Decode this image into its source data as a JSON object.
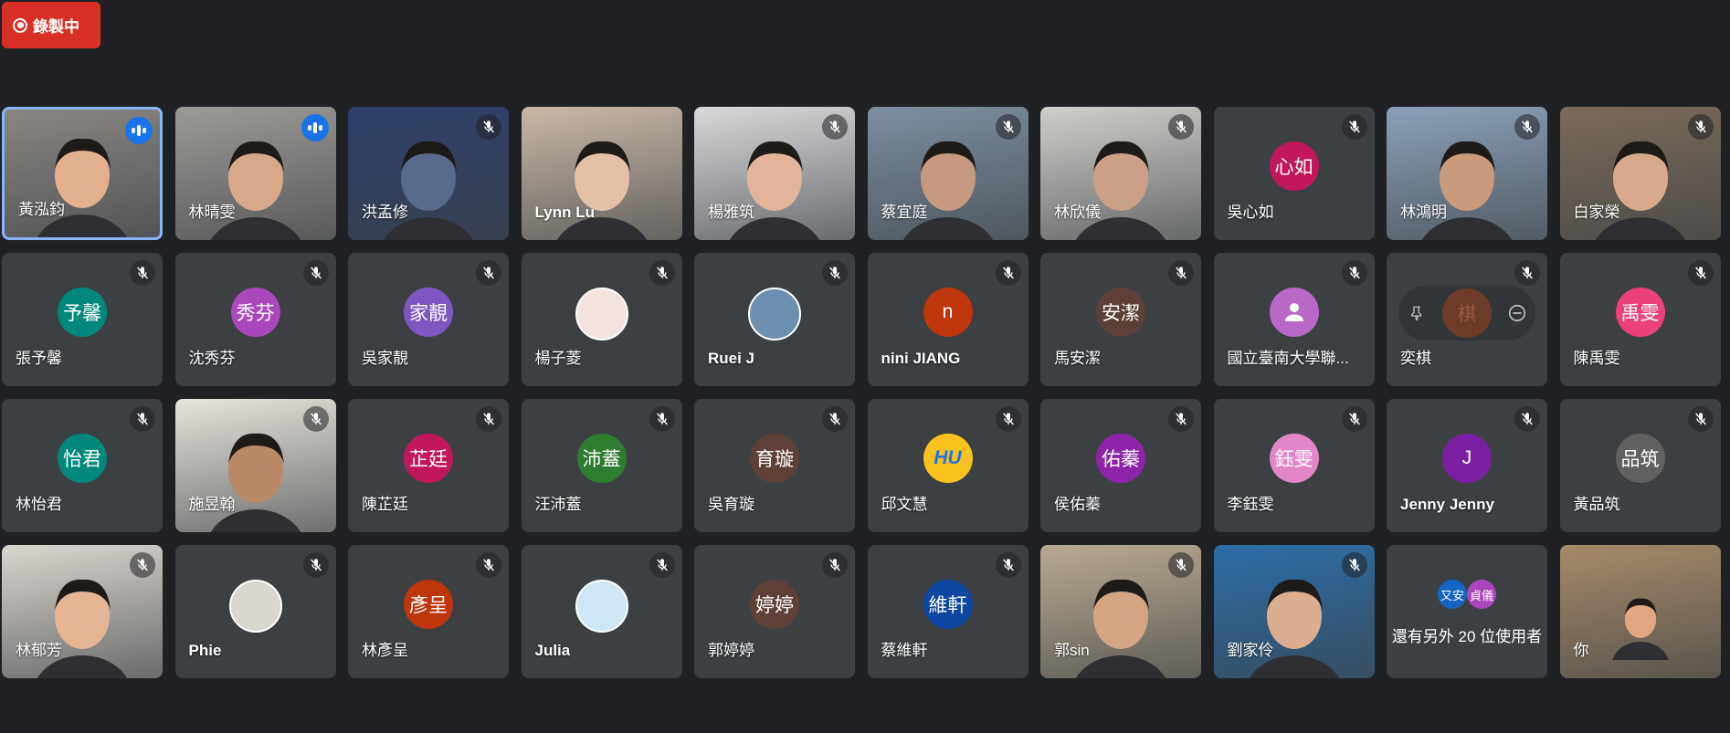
{
  "recording": {
    "label": "錄製中"
  },
  "participants": [
    {
      "name": "黃泓鈞",
      "type": "video",
      "speaking": true,
      "active": true,
      "skin": "#e2b08e",
      "bg": "#8a8682"
    },
    {
      "name": "林晴雯",
      "type": "video",
      "speaking": true,
      "skin": "#d7a98b",
      "bg": "#9c9a96"
    },
    {
      "name": "洪孟修",
      "type": "video",
      "muted": true,
      "skin": "#5a6a8a",
      "bg": "#2f3f6a"
    },
    {
      "name": "Lynn Lu",
      "type": "video",
      "bold": true,
      "skin": "#e5c0a8",
      "bg": "#c9b8a8"
    },
    {
      "name": "楊雅筑",
      "type": "video",
      "muted": true,
      "skin": "#e2b59a",
      "bg": "#d9d9db"
    },
    {
      "name": "蔡宜庭",
      "type": "video",
      "muted": true,
      "skin": "#c59a80",
      "bg": "#7d8fa0"
    },
    {
      "name": "林欣儀",
      "type": "video",
      "muted": true,
      "skin": "#caa088",
      "bg": "#d0cfcb"
    },
    {
      "name": "吳心如",
      "type": "avatar",
      "muted": true,
      "initials": "心如",
      "color": "#c2185b"
    },
    {
      "name": "林鴻明",
      "type": "video",
      "muted": true,
      "skin": "#c99a7c",
      "bg": "#8ca0b8"
    },
    {
      "name": "白家榮",
      "type": "video",
      "muted": true,
      "skin": "#d8a98a",
      "bg": "#7a6a5a"
    },
    {
      "name": "張予馨",
      "type": "avatar",
      "muted": true,
      "initials": "予馨",
      "color": "#00897b"
    },
    {
      "name": "沈秀芬",
      "type": "avatar",
      "muted": true,
      "initials": "秀芬",
      "color": "#ab47bc"
    },
    {
      "name": "吳家靚",
      "type": "avatar",
      "muted": true,
      "initials": "家靚",
      "color": "#7e57c2"
    },
    {
      "name": "楊子菱",
      "type": "image",
      "muted": true,
      "color": "#f4e4e0"
    },
    {
      "name": "Ruei J",
      "type": "image",
      "muted": true,
      "bold": true,
      "color": "#6d8fb0"
    },
    {
      "name": "nini JIANG",
      "type": "avatar",
      "muted": true,
      "bold": true,
      "initials": "n",
      "color": "#bf360c"
    },
    {
      "name": "馬安潔",
      "type": "avatar",
      "muted": true,
      "initials": "安潔",
      "color": "#5d4037"
    },
    {
      "name": "國立臺南大學聯...",
      "type": "avatar",
      "muted": true,
      "initials": "",
      "color": "#ba68c8",
      "generic": true
    },
    {
      "name": "奕棋",
      "type": "hover",
      "muted": true,
      "initials": "棋",
      "color": "#6d3b2a"
    },
    {
      "name": "陳禹雯",
      "type": "avatar",
      "muted": true,
      "initials": "禹雯",
      "color": "#ec407a"
    },
    {
      "name": "林怡君",
      "type": "avatar",
      "muted": true,
      "initials": "怡君",
      "color": "#00897b"
    },
    {
      "name": "施昱翰",
      "type": "video",
      "muted": true,
      "skin": "#b98a6a",
      "bg": "#e8e4dc"
    },
    {
      "name": "陳芷廷",
      "type": "avatar",
      "muted": true,
      "initials": "芷廷",
      "color": "#c2185b"
    },
    {
      "name": "汪沛蓋",
      "type": "avatar",
      "muted": true,
      "initials": "沛蓋",
      "color": "#2e7d32"
    },
    {
      "name": "吳育璇",
      "type": "avatar",
      "muted": true,
      "initials": "育璇",
      "color": "#5d4037"
    },
    {
      "name": "邱文慧",
      "type": "avatar",
      "muted": true,
      "initials": "HU",
      "color": "#f9c21f"
    },
    {
      "name": "侯佑蓁",
      "type": "avatar",
      "muted": true,
      "initials": "佑蓁",
      "color": "#8e24aa"
    },
    {
      "name": "李鈺雯",
      "type": "avatar",
      "muted": true,
      "initials": "鈺雯",
      "color": "#e386c8"
    },
    {
      "name": "Jenny Jenny",
      "type": "avatar",
      "muted": true,
      "bold": true,
      "initials": "J",
      "color": "#7b1fa2"
    },
    {
      "name": "黃品筑",
      "type": "avatar",
      "muted": true,
      "initials": "品筑",
      "color": "#616161"
    },
    {
      "name": "林郁芳",
      "type": "video",
      "muted": true,
      "skin": "#e4b494",
      "bg": "#dcd6cf"
    },
    {
      "name": "Phie",
      "type": "image",
      "muted": true,
      "bold": true,
      "color": "#d9d5cf"
    },
    {
      "name": "林彥呈",
      "type": "avatar",
      "muted": true,
      "initials": "彥呈",
      "color": "#bf360c"
    },
    {
      "name": "Julia",
      "type": "image",
      "muted": true,
      "bold": true,
      "color": "#cfe6f5"
    },
    {
      "name": "郭婷婷",
      "type": "avatar",
      "muted": true,
      "initials": "婷婷",
      "color": "#5d4037"
    },
    {
      "name": "蔡維軒",
      "type": "avatar",
      "muted": true,
      "initials": "維軒",
      "color": "#0d47a1"
    },
    {
      "name": "郭sin",
      "type": "video",
      "muted": true,
      "skin": "#d4a582",
      "bg": "#b9aa92"
    },
    {
      "name": "劉家伶",
      "type": "video",
      "muted": true,
      "skin": "#dcae90",
      "bg": "#2b6ea8"
    },
    {
      "name": "還有另外 20 位使用者",
      "type": "more",
      "avatars": [
        {
          "t": "又安",
          "c": "#1565c0"
        },
        {
          "t": "貞儀",
          "c": "#ab47bc"
        }
      ]
    },
    {
      "name": "你",
      "type": "self",
      "skin": "#e0a880",
      "bg": "#a58a6a"
    }
  ]
}
